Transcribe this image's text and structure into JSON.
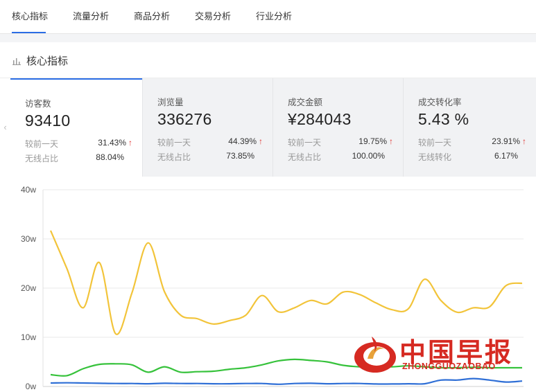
{
  "tabs": [
    {
      "label": "核心指标",
      "active": true
    },
    {
      "label": "流量分析",
      "active": false
    },
    {
      "label": "商品分析",
      "active": false
    },
    {
      "label": "交易分析",
      "active": false
    },
    {
      "label": "行业分析",
      "active": false
    }
  ],
  "section": {
    "title": "核心指标",
    "icon": "bar-chart-icon"
  },
  "metrics": [
    {
      "label": "访客数",
      "value": "93410",
      "row1_label": "较前一天",
      "row1_value": "31.43%",
      "row2_label": "无线占比",
      "row2_value": "88.04%",
      "trend": "up",
      "active": true
    },
    {
      "label": "浏览量",
      "value": "336276",
      "row1_label": "较前一天",
      "row1_value": "44.39%",
      "row2_label": "无线占比",
      "row2_value": "73.85%",
      "trend": "up",
      "active": false
    },
    {
      "label": "成交金额",
      "value": "¥284043",
      "row1_label": "较前一天",
      "row1_value": "19.75%",
      "row2_label": "无线占比",
      "row2_value": "100.00%",
      "trend": "up",
      "active": false
    },
    {
      "label": "成交转化率",
      "value": "5.43 %",
      "row1_label": "较前一天",
      "row1_value": "23.91%",
      "row2_label": "无线转化",
      "row2_value": "6.17%",
      "trend": "up",
      "active": false
    }
  ],
  "trend_arrow": "↑",
  "scroll_left_icon": "‹",
  "colors": {
    "accent": "#2b6de5",
    "up": "#e0312e",
    "series_yellow": "#f2c43a",
    "series_green": "#36c23b",
    "series_blue": "#2f6fd6",
    "watermark": "#d62a22"
  },
  "chart_data": {
    "type": "line",
    "yticks": [
      "40w",
      "30w",
      "20w",
      "10w",
      "0w"
    ],
    "ylim": [
      0,
      400000
    ],
    "grid": true,
    "series": [
      {
        "color": "#f2c43a",
        "values": [
          317000,
          240000,
          160000,
          252000,
          107000,
          190000,
          292000,
          193000,
          145000,
          138000,
          127000,
          134000,
          145000,
          185000,
          152000,
          160000,
          175000,
          168000,
          192000,
          187000,
          170000,
          156000,
          158000,
          218000,
          175000,
          151000,
          160000,
          162000,
          205000,
          210000
        ]
      },
      {
        "color": "#36c23b",
        "values": [
          24000,
          22000,
          36000,
          45000,
          46000,
          44000,
          29000,
          40000,
          29000,
          30000,
          31000,
          35000,
          38000,
          44000,
          52000,
          55000,
          53000,
          50000,
          43000,
          40000,
          40000,
          40000,
          42000,
          40000,
          38000,
          38000,
          39000,
          38000,
          38000,
          38000
        ]
      },
      {
        "color": "#2f6fd6",
        "values": [
          7000,
          7500,
          7000,
          6500,
          6000,
          6000,
          5500,
          6500,
          6000,
          6000,
          5500,
          5500,
          6000,
          6000,
          4500,
          6000,
          6500,
          5500,
          6000,
          6000,
          5000,
          5000,
          5500,
          5500,
          13000,
          13000,
          16000,
          13000,
          9000,
          11000
        ]
      }
    ]
  },
  "watermark": {
    "title": "中国早报",
    "subtitle": "ZHONGGUOZAOBAO"
  }
}
